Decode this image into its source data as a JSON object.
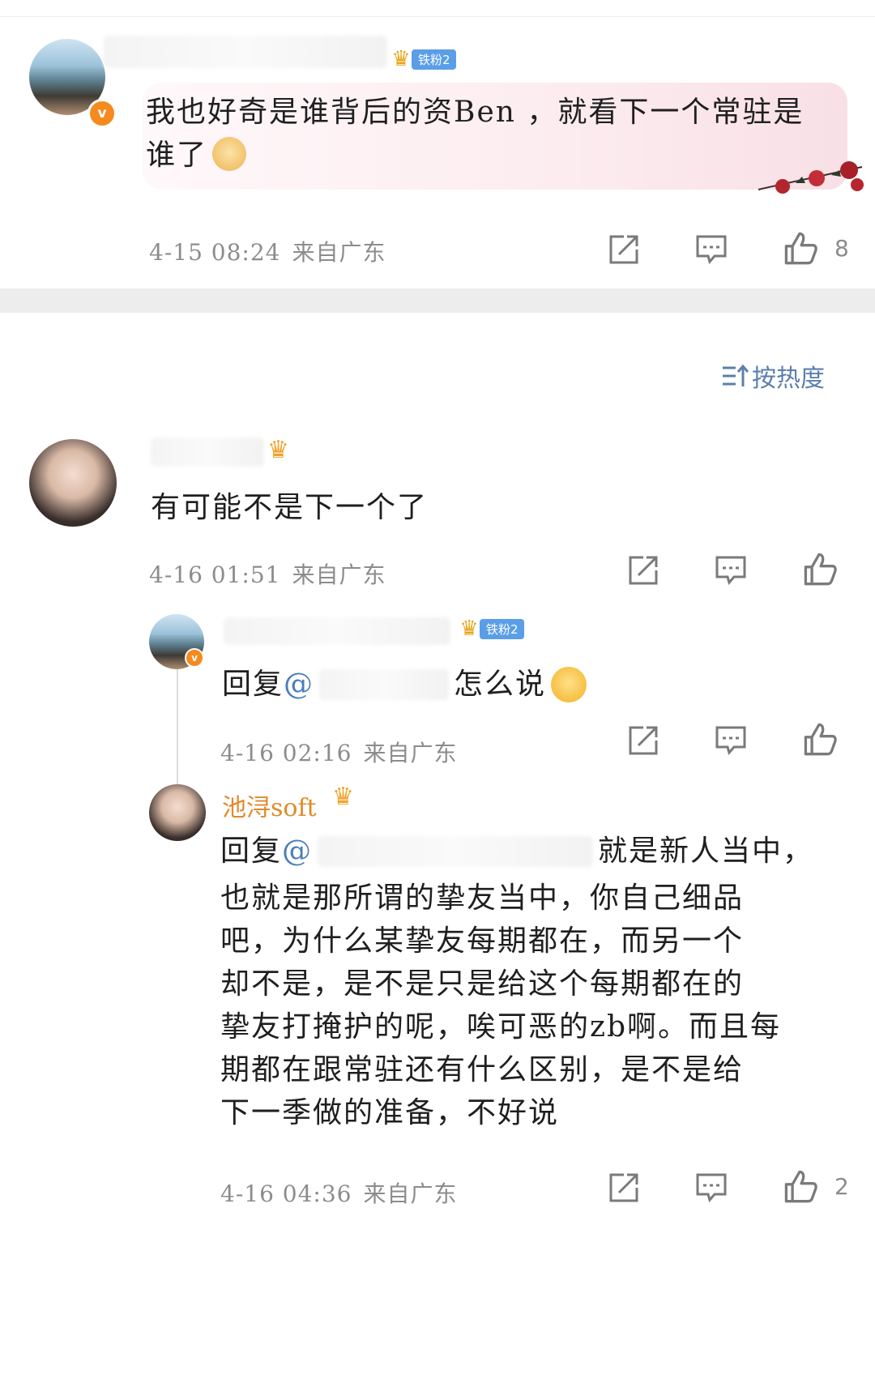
{
  "sort": {
    "label": "按热度"
  },
  "comments": [
    {
      "badge": "铁粉2",
      "text": "我也好奇是谁背后的资Ben ，就看下一个常驻是谁了",
      "time": "4-15 08:24",
      "location": "来自广东",
      "likes": "8"
    },
    {
      "text": "有可能不是下一个了",
      "time": "4-16 01:51",
      "location": "来自广东",
      "replies": [
        {
          "badge": "铁粉2",
          "reply_prefix": "回复",
          "at": "@",
          "text": "怎么说",
          "time": "4-16 02:16",
          "location": "来自广东"
        },
        {
          "name": "池浔soft",
          "reply_prefix": "回复",
          "at": "@",
          "lines": [
            "就是新人当中，",
            "也就是那所谓的挚友当中，你自己细品",
            "吧，为什么某挚友每期都在，而另一个",
            "却不是，是不是只是给这个每期都在的",
            "挚友打掩护的呢，唉可恶的zb啊。而且每",
            "期都在跟常驻还有什么区别，是不是给",
            "下一季做的准备，不好说"
          ],
          "time": "4-16 04:36",
          "location": "来自广东",
          "likes": "2"
        }
      ]
    }
  ],
  "icons": {
    "share": "share-icon",
    "comment": "comment-icon",
    "like": "thumbs-up-icon",
    "crown": "crown-icon",
    "sort": "sort-icon",
    "verified": "verified-badge-icon",
    "emoji_dog": "doge-emoji-icon",
    "emoji_think": "thinking-emoji-icon"
  }
}
